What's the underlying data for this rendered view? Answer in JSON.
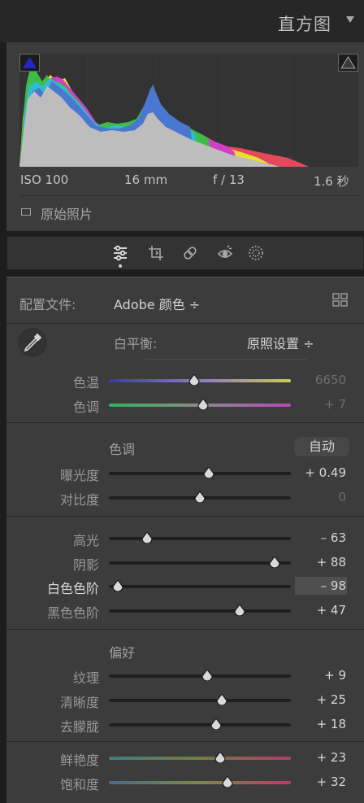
{
  "header": {
    "title": "直方图"
  },
  "histogram": {
    "iso": "ISO 100",
    "focal": "16 mm",
    "aperture": "f / 13",
    "shutter": "1.6 秒",
    "original_photo_label": "原始照片"
  },
  "tools": [
    "sliders-icon",
    "crop-icon",
    "healing-icon",
    "redeye-icon",
    "mask-icon"
  ],
  "basic": {
    "profile_label": "配置文件:",
    "profile_value": "Adobe 颜色 ÷",
    "wb_label": "白平衡:",
    "wb_value": "原照设置 ÷",
    "tone_header": "色调",
    "auto_label": "自动",
    "presence_header": "偏好",
    "sliders": [
      {
        "key": "temp",
        "label": "色温",
        "value": "6650",
        "pos": 0.47,
        "dim": true
      },
      {
        "key": "tint",
        "label": "色调",
        "value": "+ 7",
        "pos": 0.52,
        "dim": true
      },
      {
        "key": "exposure",
        "label": "曝光度",
        "value": "+ 0.49",
        "pos": 0.55
      },
      {
        "key": "contrast",
        "label": "对比度",
        "value": "0",
        "pos": 0.5,
        "dim": true
      },
      {
        "key": "highlights",
        "label": "高光",
        "value": "– 63",
        "pos": 0.21
      },
      {
        "key": "shadows",
        "label": "阴影",
        "value": "+ 88",
        "pos": 0.91
      },
      {
        "key": "whites",
        "label": "白色色阶",
        "value": "– 98",
        "pos": 0.05,
        "bright": true
      },
      {
        "key": "blacks",
        "label": "黑色色阶",
        "value": "+ 47",
        "pos": 0.72
      },
      {
        "key": "texture",
        "label": "纹理",
        "value": "+ 9",
        "pos": 0.54
      },
      {
        "key": "clarity",
        "label": "清晰度",
        "value": "+ 25",
        "pos": 0.62
      },
      {
        "key": "dehaze",
        "label": "去朦胧",
        "value": "+ 18",
        "pos": 0.59
      },
      {
        "key": "vibrance",
        "label": "鲜艳度",
        "value": "+ 23",
        "pos": 0.61
      },
      {
        "key": "saturation",
        "label": "饱和度",
        "value": "+ 32",
        "pos": 0.65
      }
    ]
  },
  "colors": {
    "panel": "#3c3c3c",
    "track_temp": "linear-gradient(to right,#3b3bb8,#c8c864)",
    "track_tint": "linear-gradient(to right,#4cc06c,#c04cc0)",
    "track_color": "linear-gradient(to right,#3c8a8a,#8a8a3c,#b03c6c)"
  }
}
